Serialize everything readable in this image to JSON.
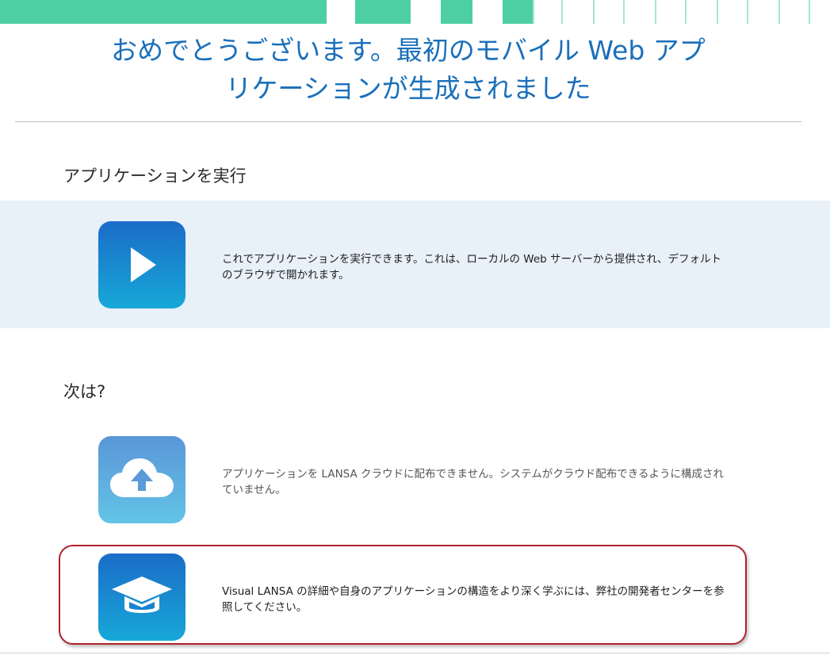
{
  "title": {
    "line1": "おめでとうございます。最初のモバイル Web アプ",
    "line2": "リケーションが生成されました"
  },
  "run_section": {
    "heading": "アプリケーションを実行",
    "description": "これでアプリケーションを実行できます。これは、ローカルの Web サーバーから提供され、デフォルトのブラウザで開かれます。",
    "icon": "play-icon"
  },
  "next_section": {
    "heading": "次は?",
    "items": [
      {
        "icon": "cloud-upload-icon",
        "description": "アプリケーションを LANSA クラウドに配布できません。システムがクラウド配布できるように構成されていません。"
      },
      {
        "icon": "graduation-cap-icon",
        "description": "Visual LANSA の詳細や自身のアプリケーションの構造をより深く学ぶには、弊社の開発者センターを参照してください。"
      }
    ]
  },
  "colors": {
    "title": "#1a6fba",
    "strip": "#4ecfa3",
    "band": "#e8f0f8",
    "highlight_border": "#b0232a"
  }
}
